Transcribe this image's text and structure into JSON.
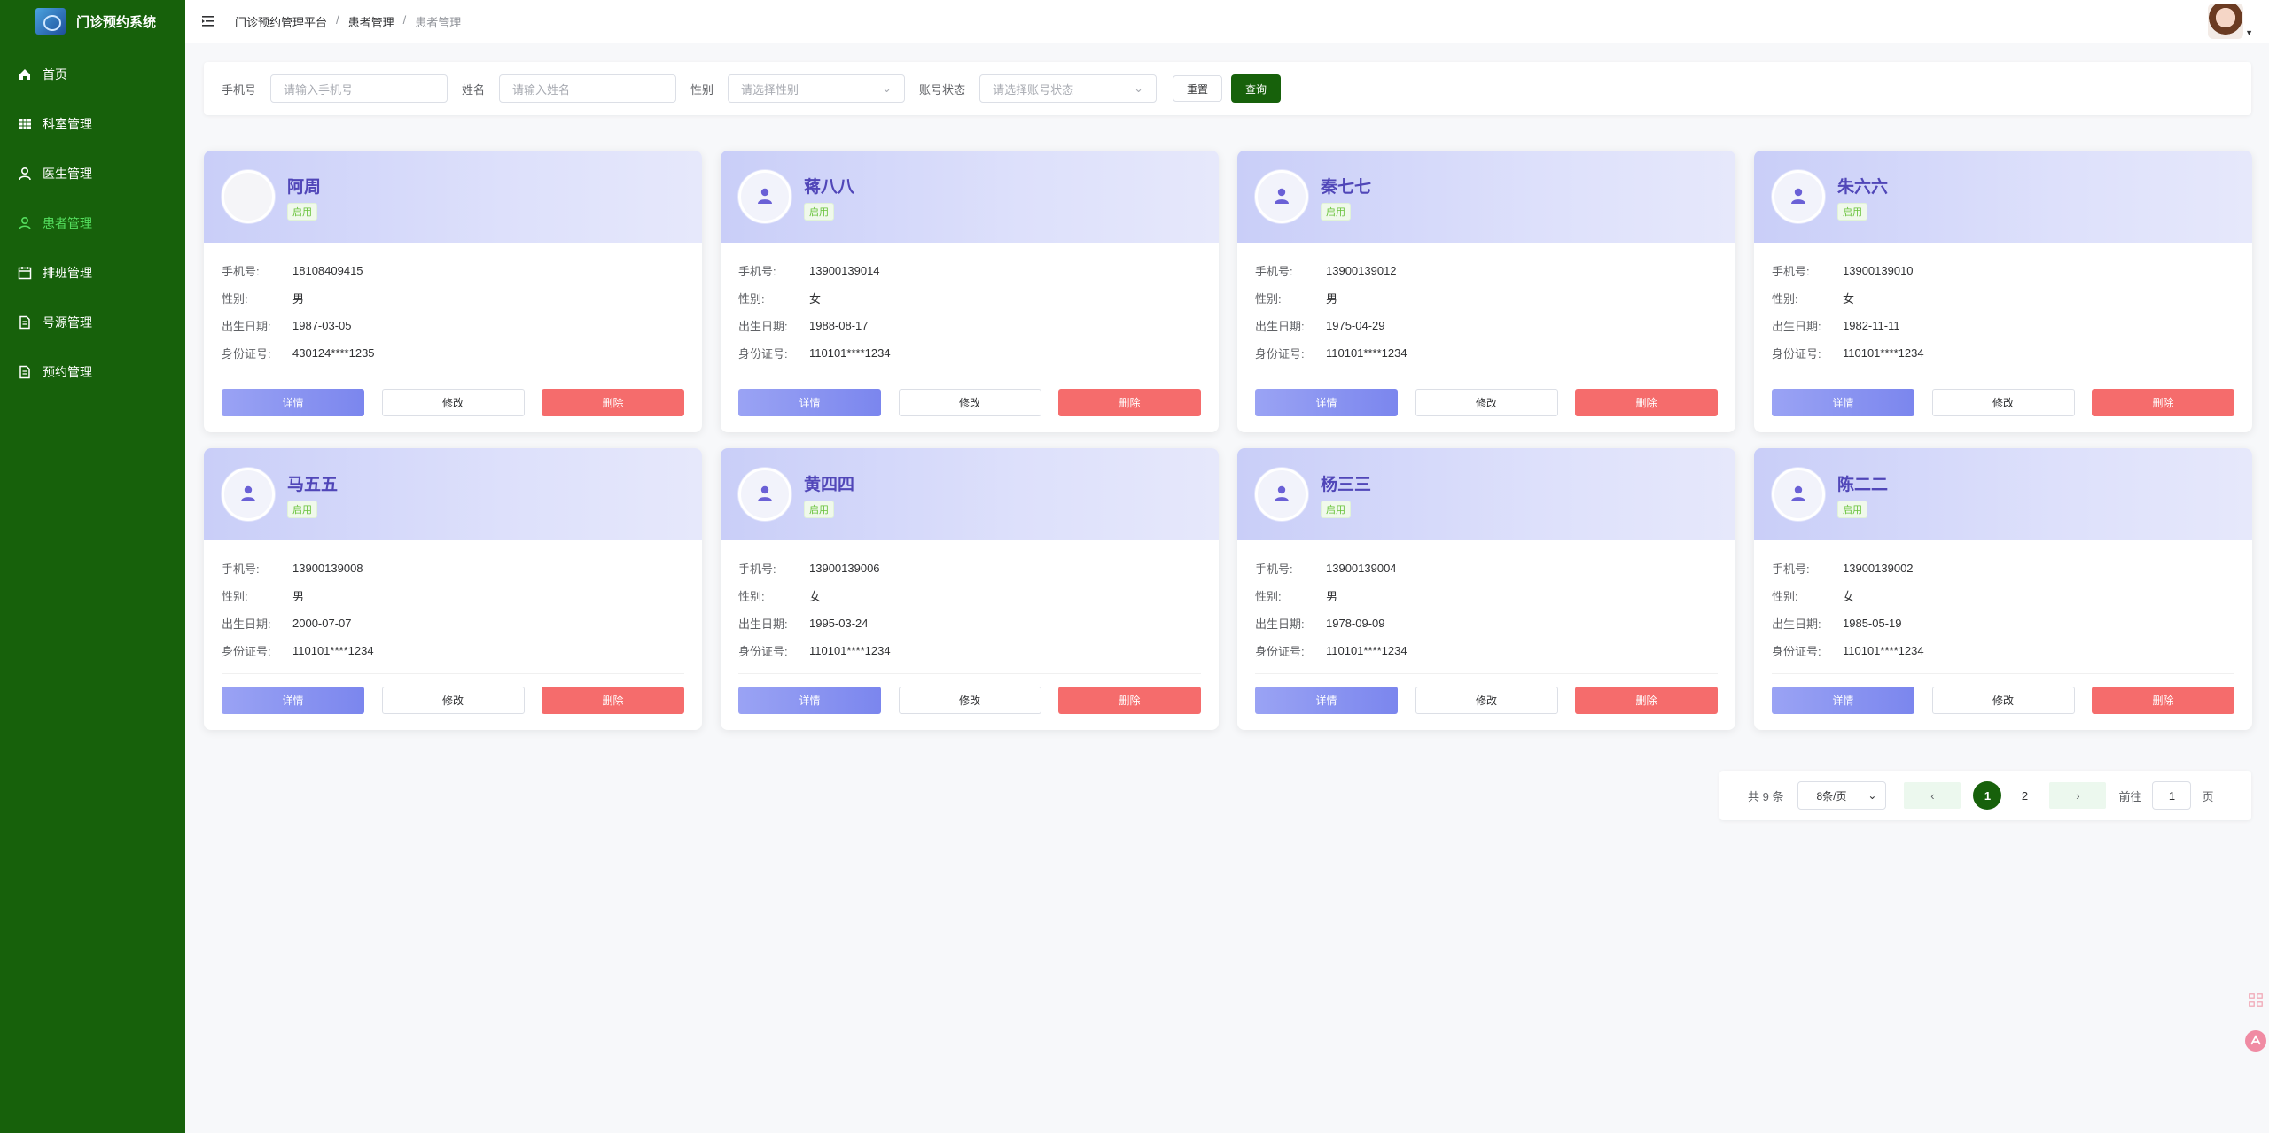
{
  "app": {
    "title": "门诊预约系统"
  },
  "menu": [
    {
      "label": "首页",
      "icon": "home-icon"
    },
    {
      "label": "科室管理",
      "icon": "grid-icon"
    },
    {
      "label": "医生管理",
      "icon": "user-icon"
    },
    {
      "label": "患者管理",
      "icon": "user-icon",
      "active": true
    },
    {
      "label": "排班管理",
      "icon": "calendar-icon"
    },
    {
      "label": "号源管理",
      "icon": "document-icon"
    },
    {
      "label": "预约管理",
      "icon": "document-icon"
    }
  ],
  "breadcrumb": [
    "门诊预约管理平台",
    "患者管理",
    "患者管理"
  ],
  "search": {
    "phone_label": "手机号",
    "phone_placeholder": "请输入手机号",
    "name_label": "姓名",
    "name_placeholder": "请输入姓名",
    "gender_label": "性别",
    "gender_placeholder": "请选择性别",
    "status_label": "账号状态",
    "status_placeholder": "请选择账号状态",
    "reset_label": "重置",
    "query_label": "查询"
  },
  "labels": {
    "phone": "手机号:",
    "gender": "性别:",
    "birth": "出生日期:",
    "idcard": "身份证号:",
    "detail": "详情",
    "edit": "修改",
    "delete": "删除"
  },
  "patients": [
    {
      "name": "阿周",
      "status": "启用",
      "phone": "18108409415",
      "gender": "男",
      "birth": "1987-03-05",
      "idcard": "430124****1235",
      "avatar": "blank"
    },
    {
      "name": "蒋八八",
      "status": "启用",
      "phone": "13900139014",
      "gender": "女",
      "birth": "1988-08-17",
      "idcard": "110101****1234",
      "avatar": "user"
    },
    {
      "name": "秦七七",
      "status": "启用",
      "phone": "13900139012",
      "gender": "男",
      "birth": "1975-04-29",
      "idcard": "110101****1234",
      "avatar": "user"
    },
    {
      "name": "朱六六",
      "status": "启用",
      "phone": "13900139010",
      "gender": "女",
      "birth": "1982-11-11",
      "idcard": "110101****1234",
      "avatar": "user"
    },
    {
      "name": "马五五",
      "status": "启用",
      "phone": "13900139008",
      "gender": "男",
      "birth": "2000-07-07",
      "idcard": "110101****1234",
      "avatar": "user"
    },
    {
      "name": "黄四四",
      "status": "启用",
      "phone": "13900139006",
      "gender": "女",
      "birth": "1995-03-24",
      "idcard": "110101****1234",
      "avatar": "user"
    },
    {
      "name": "杨三三",
      "status": "启用",
      "phone": "13900139004",
      "gender": "男",
      "birth": "1978-09-09",
      "idcard": "110101****1234",
      "avatar": "user"
    },
    {
      "name": "陈二二",
      "status": "启用",
      "phone": "13900139002",
      "gender": "女",
      "birth": "1985-05-19",
      "idcard": "110101****1234",
      "avatar": "user"
    }
  ],
  "pagination": {
    "total_text": "共 9 条",
    "page_size": "8条/页",
    "pages": [
      "1",
      "2"
    ],
    "current": "1",
    "goto_label": "前往",
    "goto_value": "1",
    "page_unit": "页"
  },
  "colors": {
    "sidebar": "#17610b",
    "accent": "#17610b",
    "delete": "#f56c6c",
    "detail": "#7b86ee",
    "name": "#5046b8"
  }
}
